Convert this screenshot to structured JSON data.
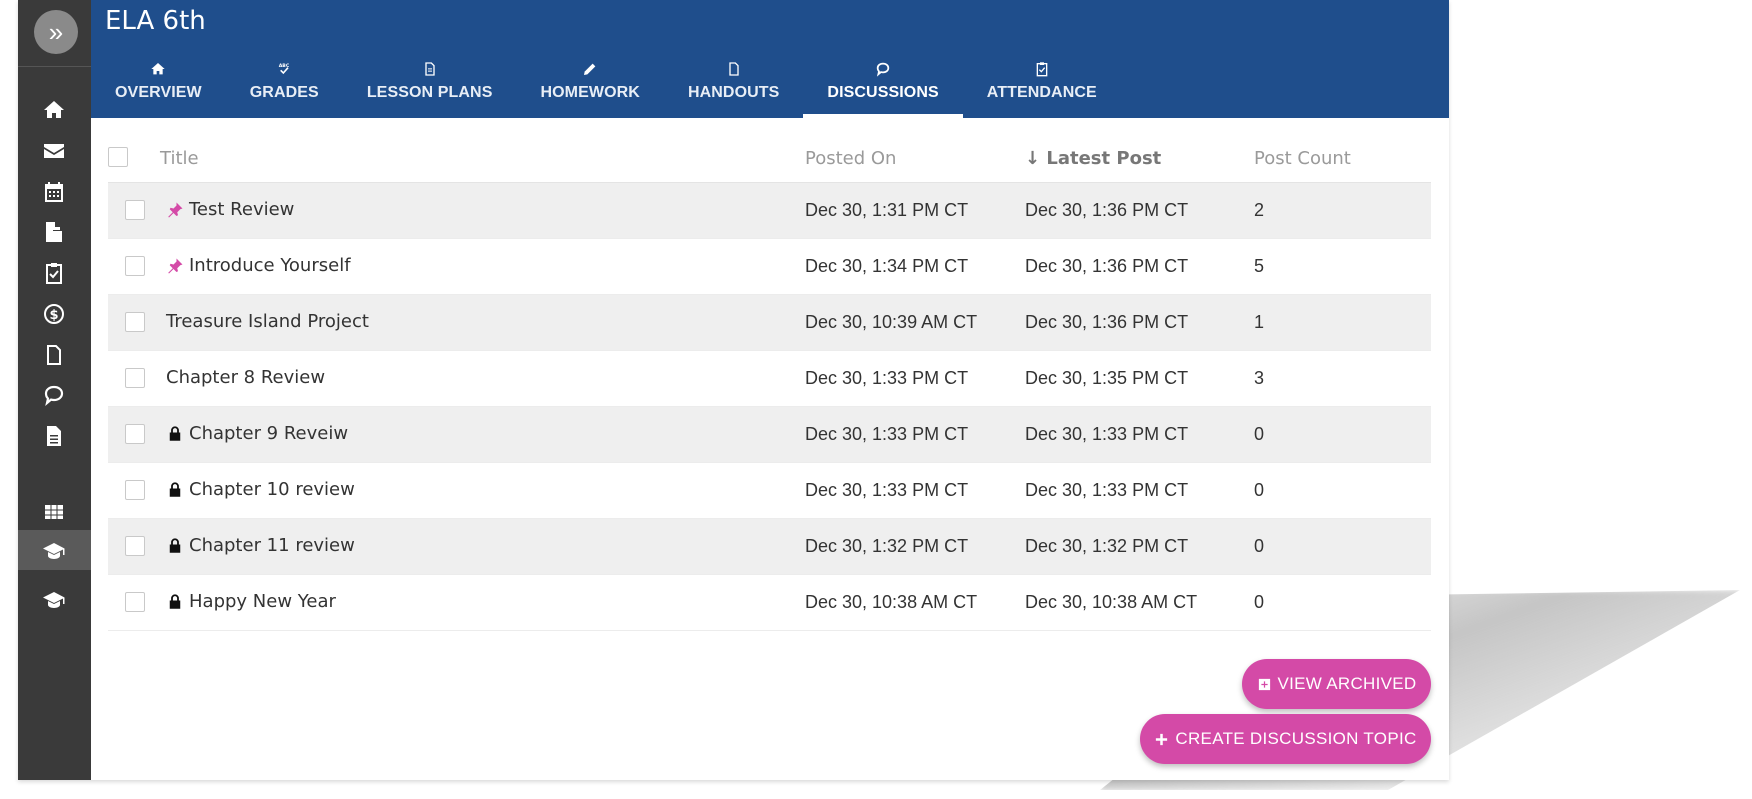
{
  "app": {
    "course_title": "ELA 6th"
  },
  "sidebar": {
    "expand_glyph": "»",
    "items": [
      {
        "icon": "home-icon"
      },
      {
        "icon": "mail-icon"
      },
      {
        "icon": "calendar-icon"
      },
      {
        "icon": "copy-icon"
      },
      {
        "icon": "clipboard-check-icon"
      },
      {
        "icon": "dollar-icon"
      },
      {
        "icon": "file-icon"
      },
      {
        "icon": "chat-icon"
      },
      {
        "icon": "document-icon"
      },
      {
        "icon": "grid-icon"
      },
      {
        "icon": "graduation-cap-icon",
        "active": true
      },
      {
        "icon": "graduation-cap-icon"
      }
    ]
  },
  "tabs": [
    {
      "label": "OVERVIEW",
      "icon": "home-icon"
    },
    {
      "label": "GRADES",
      "icon": "grades-icon"
    },
    {
      "label": "LESSON PLANS",
      "icon": "document-icon"
    },
    {
      "label": "HOMEWORK",
      "icon": "pencil-icon"
    },
    {
      "label": "HANDOUTS",
      "icon": "file-icon"
    },
    {
      "label": "DISCUSSIONS",
      "icon": "chat-icon",
      "active": true
    },
    {
      "label": "ATTENDANCE",
      "icon": "clipboard-check-icon"
    }
  ],
  "table": {
    "headers": {
      "title": "Title",
      "posted_on": "Posted On",
      "latest_post": "Latest Post",
      "latest_post_sort": "↓",
      "post_count": "Post Count"
    },
    "rows": [
      {
        "title": "Test Review",
        "marker": "pin",
        "posted_on": "Dec 30, 1:31 PM CT",
        "latest_post": "Dec 30, 1:36 PM CT",
        "post_count": "2"
      },
      {
        "title": "Introduce Yourself",
        "marker": "pin",
        "posted_on": "Dec 30, 1:34 PM CT",
        "latest_post": "Dec 30, 1:36 PM CT",
        "post_count": "5"
      },
      {
        "title": "Treasure Island Project",
        "marker": "",
        "posted_on": "Dec 30, 10:39 AM CT",
        "latest_post": "Dec 30, 1:36 PM CT",
        "post_count": "1"
      },
      {
        "title": "Chapter 8 Review",
        "marker": "",
        "posted_on": "Dec 30, 1:33 PM CT",
        "latest_post": "Dec 30, 1:35 PM CT",
        "post_count": "3"
      },
      {
        "title": "Chapter 9 Reveiw",
        "marker": "lock",
        "posted_on": "Dec 30, 1:33 PM CT",
        "latest_post": "Dec 30, 1:33 PM CT",
        "post_count": "0"
      },
      {
        "title": "Chapter 10 review",
        "marker": "lock",
        "posted_on": "Dec 30, 1:33 PM CT",
        "latest_post": "Dec 30, 1:33 PM CT",
        "post_count": "0"
      },
      {
        "title": "Chapter 11 review",
        "marker": "lock",
        "posted_on": "Dec 30, 1:32 PM CT",
        "latest_post": "Dec 30, 1:32 PM CT",
        "post_count": "0"
      },
      {
        "title": "Happy New Year",
        "marker": "lock",
        "posted_on": "Dec 30, 10:38 AM CT",
        "latest_post": "Dec 30, 10:38 AM CT",
        "post_count": "0"
      }
    ]
  },
  "actions": {
    "view_archived": "VIEW ARCHIVED",
    "create_topic": "CREATE DISCUSSION TOPIC"
  },
  "colors": {
    "header_bg": "#1f4e8c",
    "sidebar_bg": "#3a3a3a",
    "accent_pink": "#d44aa7",
    "row_alt": "#efefef"
  }
}
